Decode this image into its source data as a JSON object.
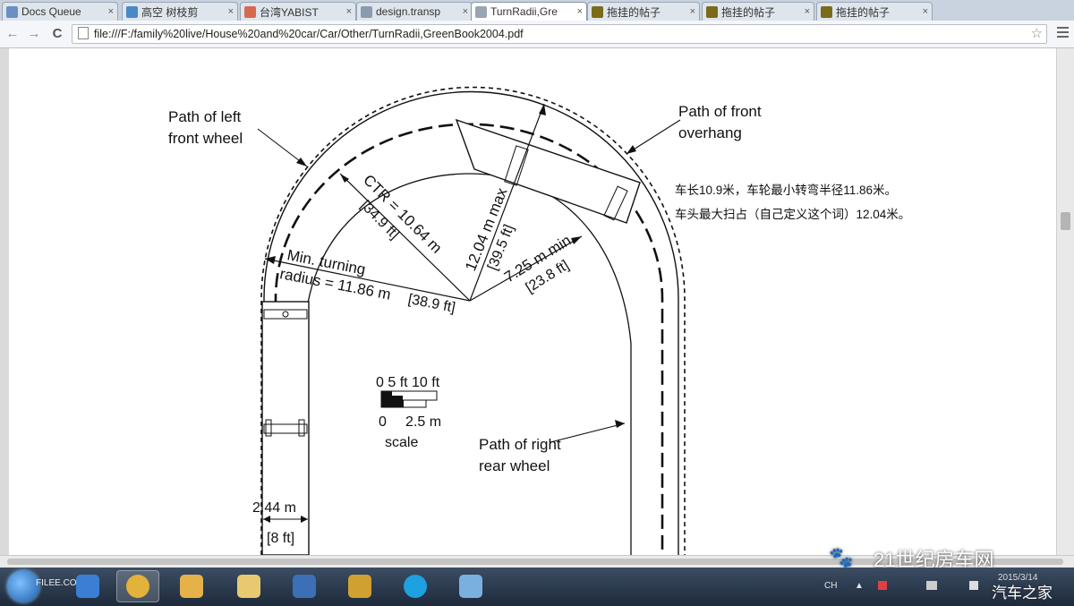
{
  "tabs": [
    {
      "label": "Docs Queue",
      "favicon_color": "#6b8fc4"
    },
    {
      "label": "高空 树枝剪",
      "favicon_color": "#4a89c8"
    },
    {
      "label": "台湾YABIST",
      "favicon_color": "#d76a4e"
    },
    {
      "label": "design.transp",
      "favicon_color": "#8a9bb0"
    },
    {
      "label": "TurnRadii,Gre",
      "favicon_color": "#9aa5b3",
      "active": true
    },
    {
      "label": "拖挂的帖子",
      "favicon_color": "#7a6a1a"
    },
    {
      "label": "拖挂的帖子",
      "favicon_color": "#7a6a1a"
    },
    {
      "label": "拖挂的帖子",
      "favicon_color": "#7a6a1a"
    }
  ],
  "tab_close_glyph": "×",
  "toolbar": {
    "back_icon": "←",
    "forward_icon": "→",
    "reload_icon": "C",
    "url": "file:///F:/family%20live/House%20and%20car/Car/Other/TurnRadii,GreenBook2004.pdf",
    "star_icon": "☆"
  },
  "diagram": {
    "labels": {
      "left_front_1": "Path of left",
      "left_front_2": "front wheel",
      "front_overhang_1": "Path of front",
      "front_overhang_2": "overhang",
      "ctr": "CTR = 10.64 m",
      "ctr_ft": "[34.9 ft]",
      "max_radius": "12.04 m max",
      "max_ft": "[39.5 ft]",
      "min_radius": "7.25 m  min.",
      "min_ft": "[23.8 ft]",
      "min_turn_1": "Min. turning",
      "min_turn_2": "radius = 11.86 m",
      "min_turn_ft": "[38.9 ft]",
      "scale_ft": "0   5 ft  10 ft",
      "scale_m_0": "0",
      "scale_m_1": "2.5 m",
      "scale_word": "scale",
      "right_rear_1": "Path of right",
      "right_rear_2": "rear wheel",
      "width_m": "2.44 m",
      "width_ft": "[8 ft]"
    },
    "note_1": "车长10.9米，车轮最小转弯半径11.86米。",
    "note_2": "车头最大扫占（自己定义这个词）12.04米。"
  },
  "taskbar": {
    "label": "FILEE.COM",
    "apps": [
      {
        "name": "ie",
        "color": "#3b7fd4"
      },
      {
        "name": "chrome",
        "color": "#e2b23a",
        "active": true
      },
      {
        "name": "mail",
        "color": "#e5b24a"
      },
      {
        "name": "explorer",
        "color": "#e8c970"
      },
      {
        "name": "shield",
        "color": "#3b6fb6"
      },
      {
        "name": "viewer",
        "color": "#d0a030"
      },
      {
        "name": "skype",
        "color": "#1ea1e0"
      },
      {
        "name": "paint",
        "color": "#7ab0e0"
      }
    ],
    "lang": "CH",
    "tray_up": "▲",
    "clock": "2015/3/14"
  },
  "watermark": {
    "main": "21世纪房车网",
    "secondary": "汽车之家",
    "icon": "🐾"
  }
}
